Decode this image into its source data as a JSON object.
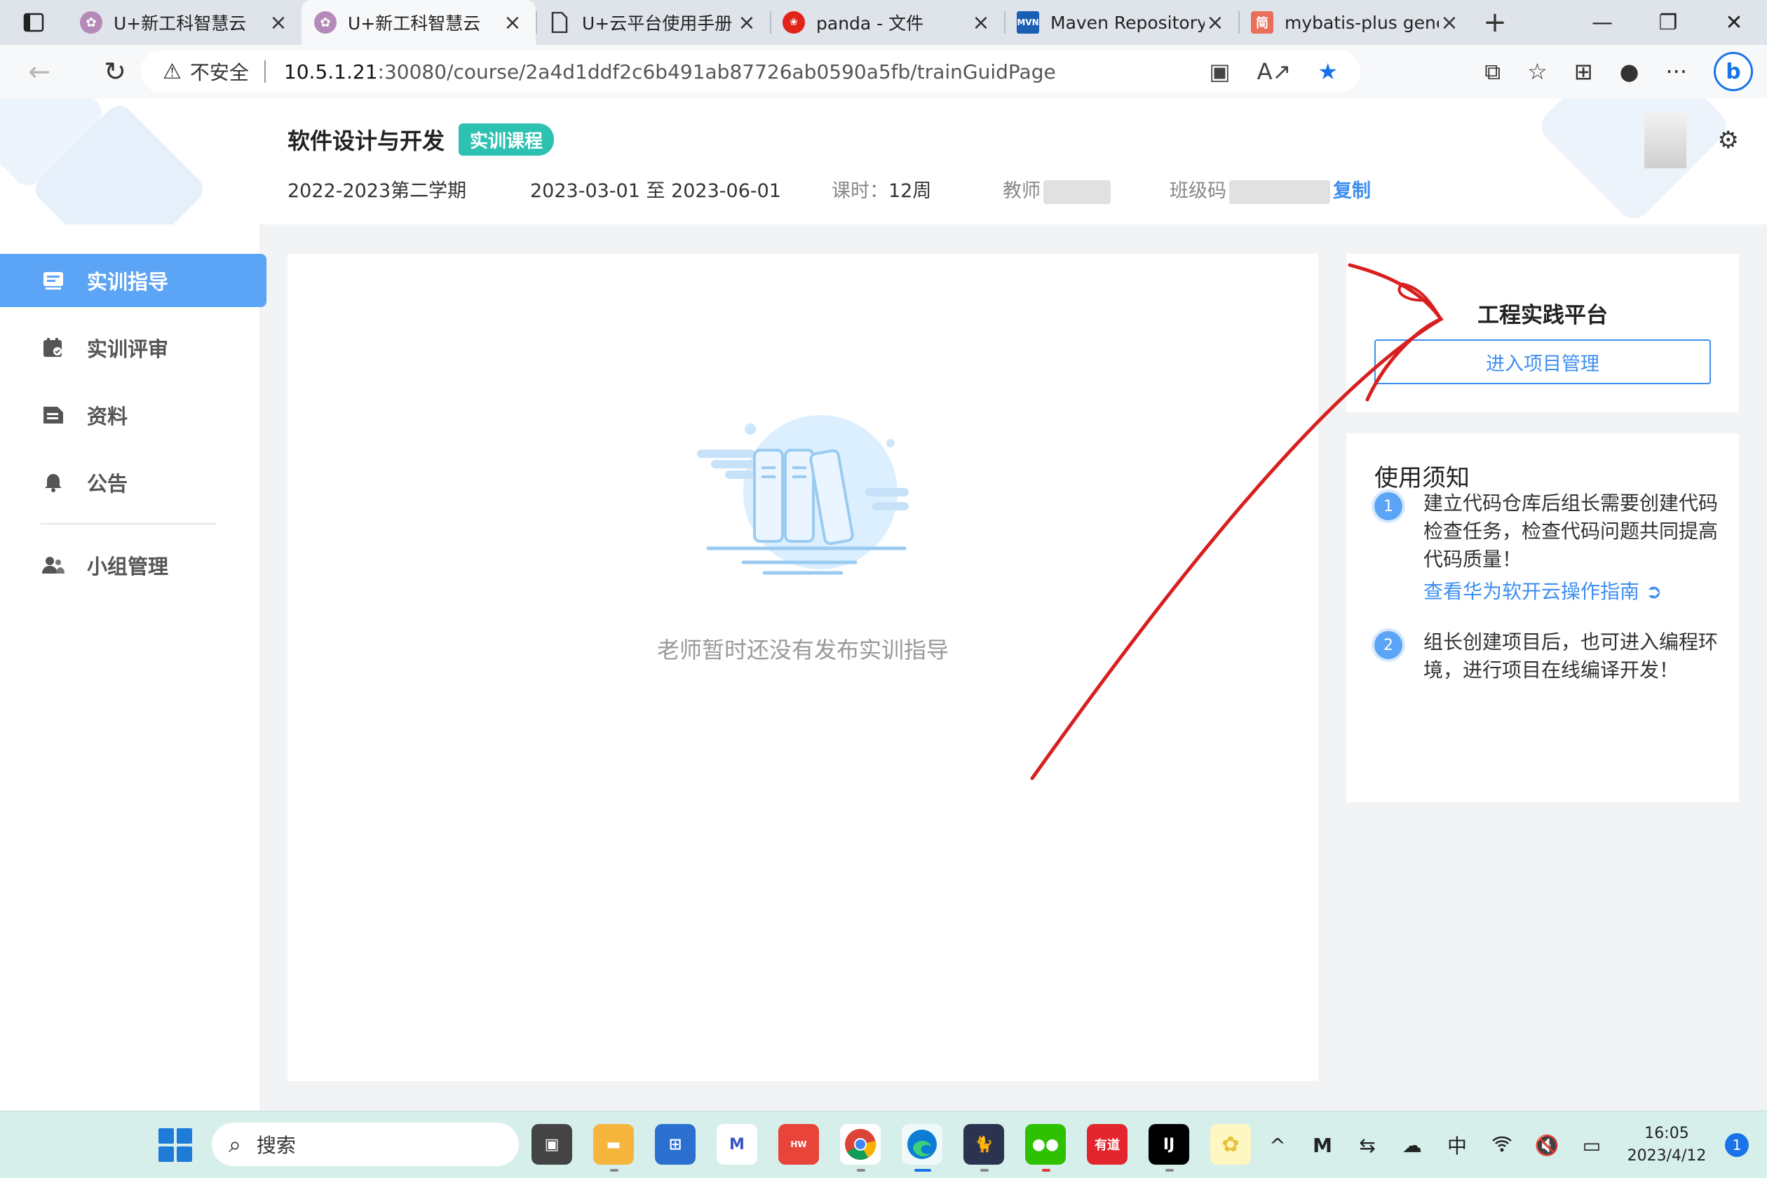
{
  "browser": {
    "tabs": [
      {
        "title": "U+新工科智慧云",
        "favicon": "university-logo-icon",
        "active": false
      },
      {
        "title": "U+新工科智慧云",
        "favicon": "university-logo-icon",
        "active": true
      },
      {
        "title": "U+云平台使用手册",
        "favicon": "document-icon",
        "active": false
      },
      {
        "title": "panda - 文件",
        "favicon": "huawei-logo-icon",
        "active": false
      },
      {
        "title": "Maven Repository:",
        "favicon": "mvn-logo-icon",
        "active": false
      },
      {
        "title": "mybatis-plus gene",
        "favicon": "jianshu-logo-icon",
        "active": false
      }
    ],
    "address": {
      "security_label": "不安全",
      "host": "10.5.1.21",
      "path": ":30080/course/2a4d1ddf2c6b491ab87726ab0590a5fb/trainGuidPage"
    },
    "accent": "#1a73e8"
  },
  "course": {
    "title": "软件设计与开发",
    "badge": "实训课程",
    "term": "2022-2023第二学期",
    "dates": "2023-03-01 至 2023-06-01",
    "hours_label": "课时：",
    "hours_value": "12周",
    "teacher_label": "教师",
    "class_code_label": "班级码",
    "copy_label": "复制"
  },
  "sidebar": {
    "items": [
      {
        "label": "实训指导",
        "icon": "guide-icon",
        "active": true
      },
      {
        "label": "实训评审",
        "icon": "review-icon",
        "active": false
      },
      {
        "label": "资料",
        "icon": "document-icon",
        "active": false
      },
      {
        "label": "公告",
        "icon": "bell-icon",
        "active": false
      },
      {
        "label": "小组管理",
        "icon": "group-icon",
        "active": false
      }
    ]
  },
  "main": {
    "empty_text": "老师暂时还没有发布实训指导"
  },
  "platform": {
    "title": "工程实践平台",
    "button": "进入项目管理"
  },
  "notice": {
    "title": "使用须知",
    "items": [
      {
        "num": "1",
        "text": "建立代码仓库后组长需要创建代码检查任务，检查代码问题共同提高代码质量！",
        "link": "查看华为软开云操作指南"
      },
      {
        "num": "2",
        "text": "组长创建项目后，也可进入编程环境，进行项目在线编译开发！"
      }
    ]
  },
  "taskbar": {
    "search_placeholder": "搜索",
    "ime": "中",
    "time": "16:05",
    "date": "2023/4/12",
    "notifications": "1"
  },
  "colors": {
    "primary": "#3d8ef0",
    "sidebar_active": "#5ba4f6",
    "badge": "#2dc1b1",
    "annotation": "#d81f1f"
  }
}
